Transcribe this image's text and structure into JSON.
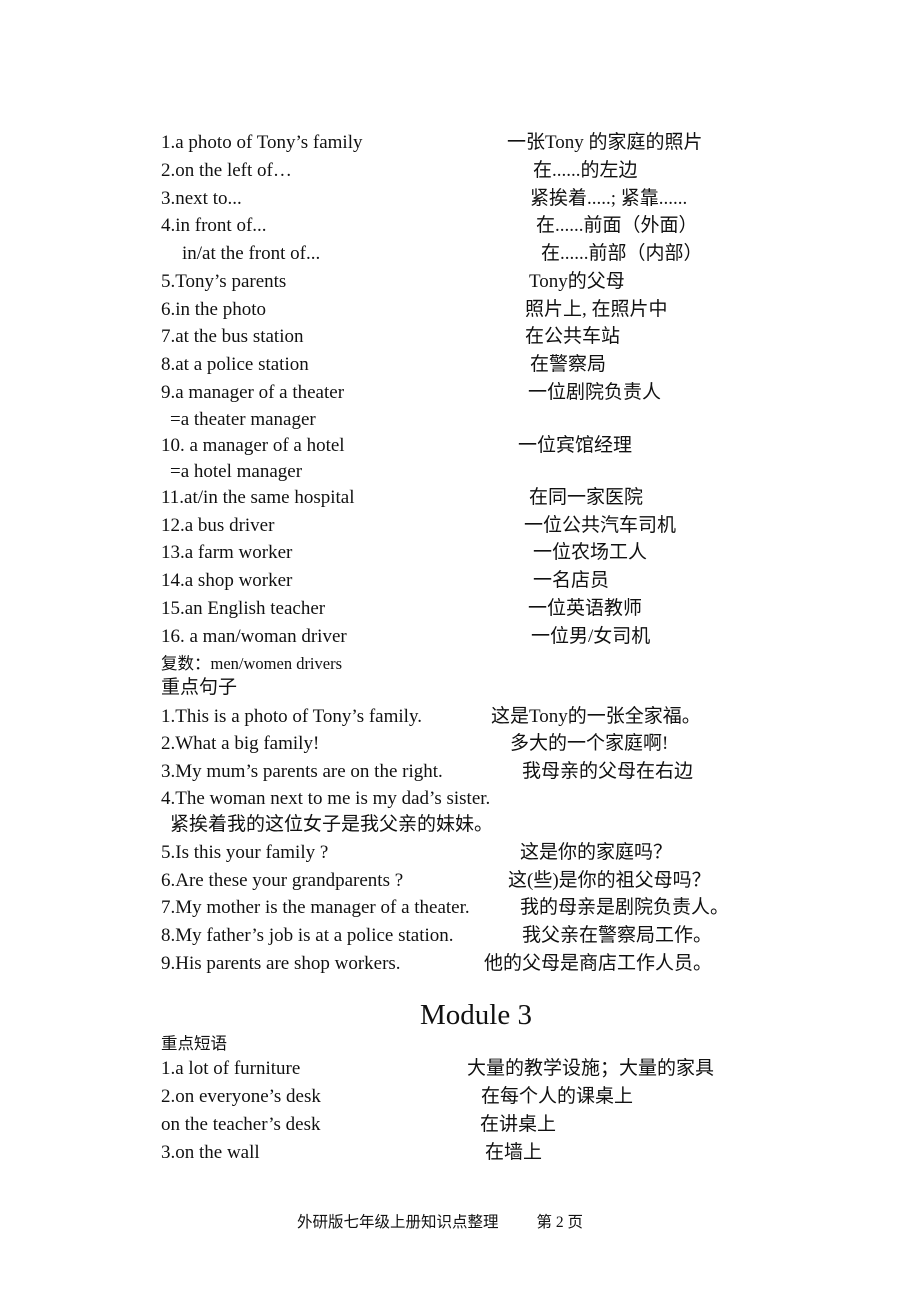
{
  "phrases": [
    {
      "en": "1.a photo of Tony’s family",
      "cn": "一张Tony  的家庭的照片"
    },
    {
      "en": "2.on the left of…",
      "cn": "在......的左边"
    },
    {
      "en": "3.next to...",
      "cn": "紧挨着.....;   紧靠......"
    },
    {
      "en": "4.in front of...",
      "cn": "在......前面（外面）"
    },
    {
      "en": "   in/at the front of...",
      "cn": "在......前部（内部）"
    },
    {
      "en": "5.Tony’s parents",
      "cn": "Tony的父母"
    },
    {
      "en": "6.in the photo",
      "cn": "照片上, 在照片中"
    },
    {
      "en": "7.at the bus station",
      "cn": "在公共车站"
    },
    {
      "en": "8.at a police station",
      "cn": "在警察局"
    },
    {
      "en": "9.a manager of a theater",
      "cn": "一位剧院负责人"
    },
    {
      "en": "  =a theater manager",
      "cn": ""
    },
    {
      "en": "10. a manager of a hotel",
      "cn": "一位宾馆经理"
    },
    {
      "en": "  =a hotel manager",
      "cn": ""
    },
    {
      "en": "11.at/in the same hospital",
      "cn": "在同一家医院"
    },
    {
      "en": "12.a bus driver",
      "cn": "一位公共汽车司机"
    },
    {
      "en": "13.a farm worker",
      "cn": "一位农场工人"
    },
    {
      "en": "14.a shop worker",
      "cn": "一名店员"
    },
    {
      "en": "15.an English teacher",
      "cn": "一位英语教师"
    },
    {
      "en": "16. a man/woman driver",
      "cn": "一位男/女司机"
    }
  ],
  "plural_note": "复数：men/women drivers",
  "sentences_heading": "重点句子",
  "sentences": [
    {
      "en": "1.This is a photo of Tony’s family.",
      "cn": "这是Tony的一张全家福。"
    },
    {
      "en": "2.What a big family!",
      "cn": "多大的一个家庭啊!"
    },
    {
      "en": "3.My mum’s parents are on the right.",
      "cn": "我母亲的父母在右边"
    },
    {
      "en": "4.The woman next to me is my dad’s sister.",
      "cn": ""
    },
    {
      "en": "  紧挨着我的这位女子是我父亲的妹妹。",
      "cn": ""
    },
    {
      "en": "5.Is this your family ?",
      "cn": "这是你的家庭吗？"
    },
    {
      "en": "6.Are these your grandparents ?",
      "cn": "这(些)是你的祖父母吗？"
    },
    {
      "en": "7.My mother is the manager of a theater.",
      "cn": "我的母亲是剧院负责人。"
    },
    {
      "en": "8.My father’s job is at a police station.",
      "cn": "我父亲在警察局工作。"
    },
    {
      "en": "9.His parents are shop workers.",
      "cn": "他的父母是商店工作人员。"
    }
  ],
  "module_title": "Module 3",
  "module3_heading": "重点短语",
  "module3_phrases": [
    {
      "en": "1.a lot of furniture",
      "cn": "大量的教学设施；大量的家具"
    },
    {
      "en": "2.on everyone’s desk",
      "cn": "在每个人的课桌上"
    },
    {
      "en": "on the teacher’s desk",
      "cn": "在讲桌上"
    },
    {
      "en": "3.on the wall",
      "cn": "在墙上"
    }
  ],
  "footer": {
    "doc_title": "外研版七年级上册知识点整理",
    "page_label": "第 2  页"
  }
}
